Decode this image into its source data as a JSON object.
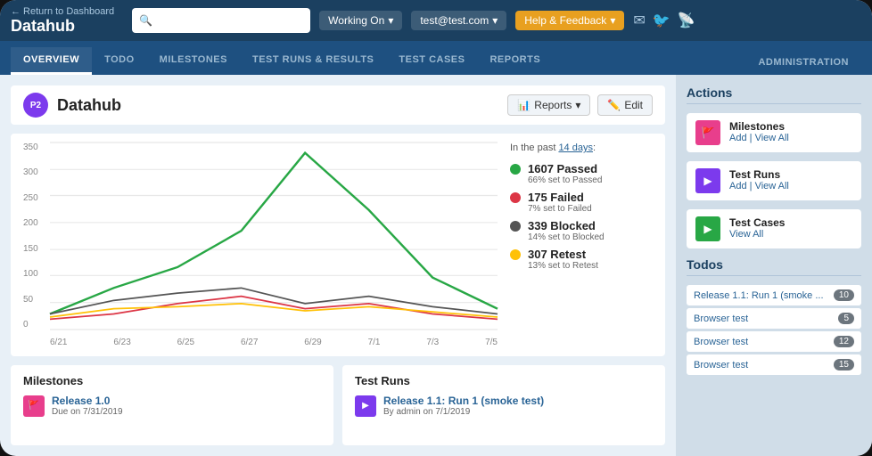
{
  "nav": {
    "back_label": "← Return to Dashboard",
    "app_title": "Datahub",
    "search_placeholder": "",
    "working_on": "Working On",
    "user": "test@test.com",
    "help": "Help & Feedback"
  },
  "tabs": [
    {
      "label": "OVERVIEW",
      "active": true
    },
    {
      "label": "TODO",
      "active": false
    },
    {
      "label": "MILESTONES",
      "active": false
    },
    {
      "label": "TEST RUNS & RESULTS",
      "active": false
    },
    {
      "label": "TEST CASES",
      "active": false
    },
    {
      "label": "REPORTS",
      "active": false
    }
  ],
  "admin_tab": "ADMINISTRATION",
  "project": {
    "badge": "P2",
    "name": "Datahub",
    "reports_btn": "Reports",
    "edit_btn": "Edit"
  },
  "chart": {
    "y_labels": [
      "350",
      "300",
      "250",
      "200",
      "150",
      "100",
      "50",
      "0"
    ],
    "x_labels": [
      "6/21",
      "6/23",
      "6/25",
      "6/27",
      "6/29",
      "7/1",
      "7/3",
      "7/5"
    ]
  },
  "stats": {
    "past_label": "In the past",
    "past_days": "14 days",
    "colon": ":",
    "items": [
      {
        "count": "1607 Passed",
        "sub": "66% set to Passed",
        "color": "#28a745"
      },
      {
        "count": "175 Failed",
        "sub": "7% set to Failed",
        "color": "#dc3545"
      },
      {
        "count": "339 Blocked",
        "sub": "14% set to Blocked",
        "color": "#555"
      },
      {
        "count": "307 Retest",
        "sub": "13% set to Retest",
        "color": "#ffc107"
      }
    ]
  },
  "milestones_section": {
    "title": "Milestones",
    "item": {
      "name": "Release 1.0",
      "due": "Due on 7/31/2019"
    }
  },
  "testruns_section": {
    "title": "Test Runs",
    "item": {
      "name": "Release 1.1: Run 1 (smoke test)",
      "by": "By admin on 7/1/2019"
    }
  },
  "actions": {
    "title": "Actions",
    "items": [
      {
        "name": "Milestones",
        "links": "Add | View All",
        "icon": "pink"
      },
      {
        "name": "Test Runs",
        "links": "Add | View All",
        "icon": "purple"
      },
      {
        "name": "Test Cases",
        "links": "View All",
        "icon": "green"
      }
    ]
  },
  "todos": {
    "title": "Todos",
    "items": [
      {
        "name": "Release 1.1: Run 1 (smoke ...",
        "count": "10"
      },
      {
        "name": "Browser test",
        "count": "5"
      },
      {
        "name": "Browser test",
        "count": "12"
      },
      {
        "name": "Browser test",
        "count": "15"
      }
    ]
  }
}
